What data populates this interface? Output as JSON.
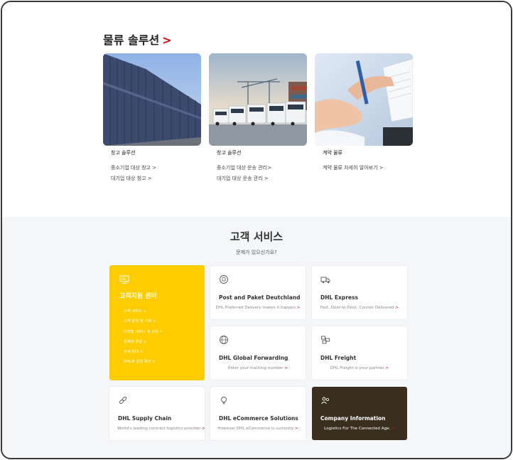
{
  "logistics": {
    "title": "물류 솔루션",
    "arrow": ">",
    "cards": [
      {
        "title": "창고 솔루션",
        "links": [
          "중소기업 대상 창고 >",
          "대기업 대상 창고 >"
        ]
      },
      {
        "title": "창고 솔루션",
        "links": [
          "중소기업 대상 운송 관리>",
          "대기업 대상 운송 관리 >"
        ]
      },
      {
        "title": "계약 물류",
        "links": [
          "계약 물류 자세히 알아보기 >"
        ]
      }
    ]
  },
  "customer_service": {
    "title": "고객 서비스",
    "subtitle": "문제가 있으신가요?",
    "center": {
      "title": "고객지원 센터",
      "links": [
        "고객 서비스 >",
        "고객 문의 및 기획 >",
        "디지털 세미나 및 교육 >",
        "통화내 수납 >",
        "관세 안내 >",
        "DHL과 운임 확인 >"
      ]
    },
    "tiles": [
      {
        "name": "Post and Paket Deutchland",
        "desc": "DHL Preferred Delivery makes it happen",
        "icon": "delivery-person-icon"
      },
      {
        "name": "DHL Express",
        "desc": "Fast, Door-to-Door, Courier Delivered",
        "icon": "express-truck-icon"
      },
      {
        "name": "DHL Global Forwarding",
        "desc": "Enter your tracking number",
        "icon": "globe-icon"
      },
      {
        "name": "DHL Freight",
        "desc": "DHL Freight is your partner",
        "icon": "freight-boxes-icon"
      },
      {
        "name": "DHL Supply Chain",
        "desc": "World's leading contract logistics provider",
        "icon": "chain-link-icon"
      },
      {
        "name": "DHL eCommerce Solutions",
        "desc": "However DHL eCommerce is currently",
        "icon": "lightbulb-icon"
      },
      {
        "name": "Company Information",
        "desc": "Logistics For The Connected Age.",
        "icon": "company-people-icon"
      }
    ],
    "gt": ">"
  },
  "colors": {
    "accent": "#d40511",
    "yellow": "#ffcc00",
    "dark_tile": "#3a2e1e"
  }
}
